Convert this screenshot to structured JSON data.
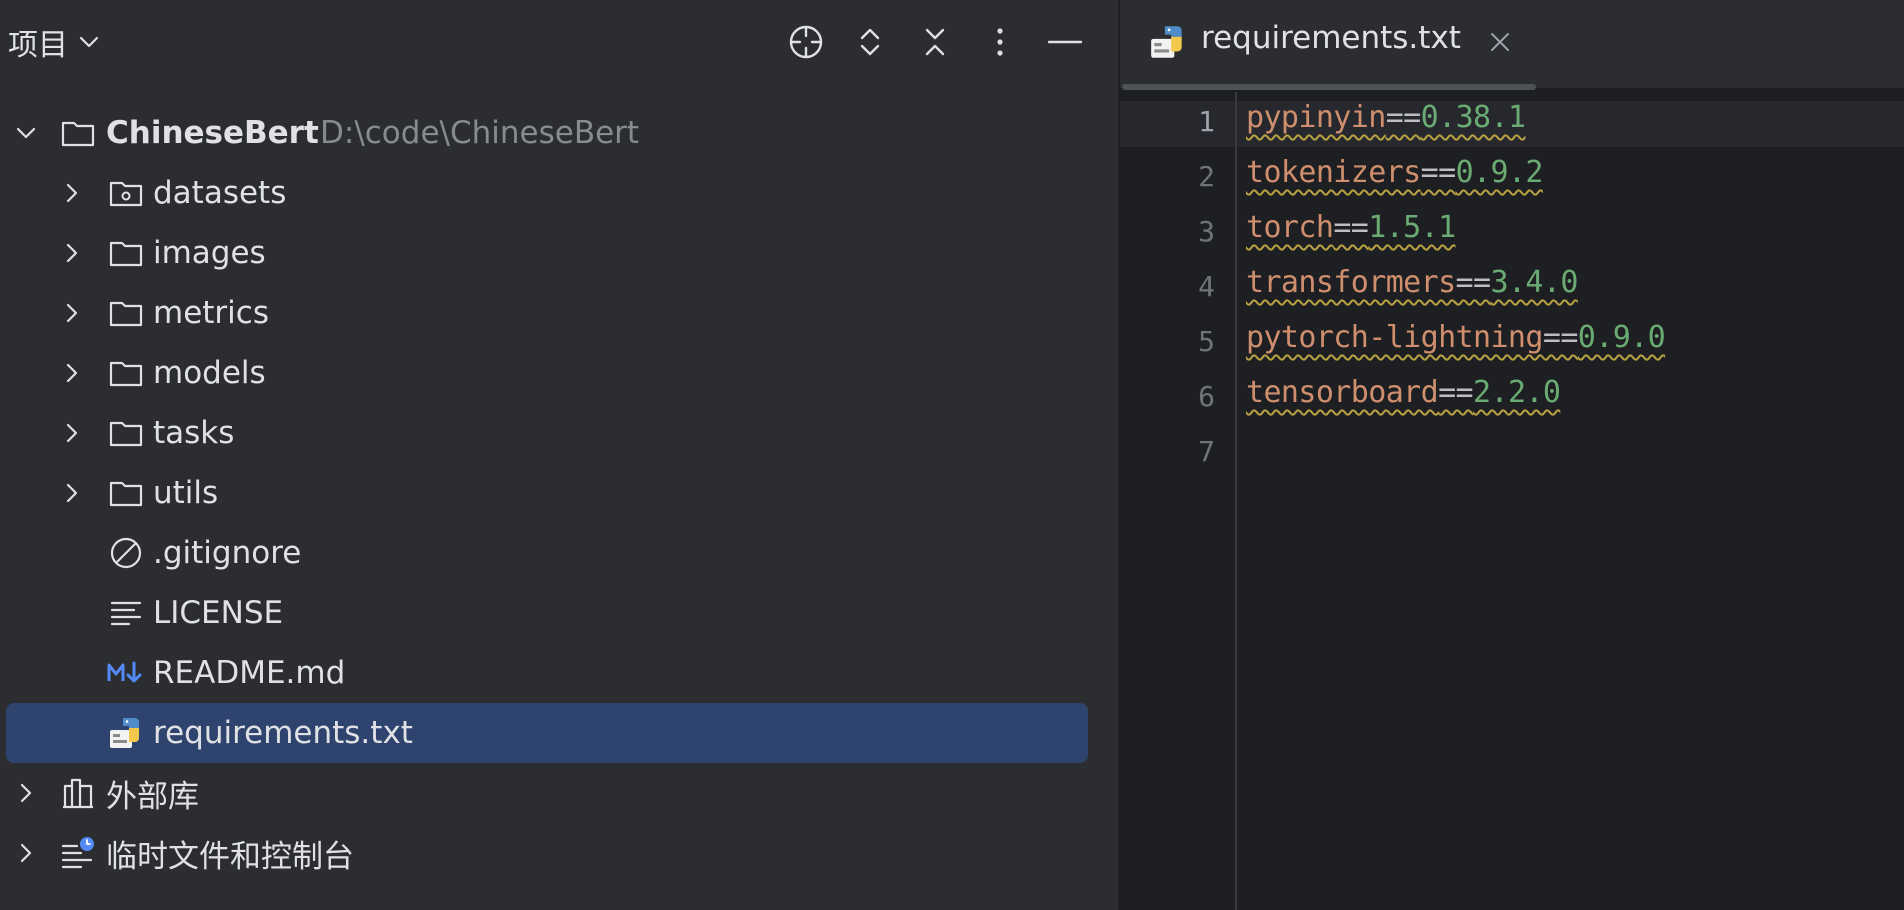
{
  "panel": {
    "title": "项目",
    "header_icons": [
      "crosshair-icon",
      "expand-collapse-icon",
      "collapse-all-icon",
      "more-vertical-icon",
      "minimize-icon"
    ]
  },
  "tree": {
    "root": {
      "name": "ChineseBert",
      "path": "D:\\code\\ChineseBert"
    },
    "items": [
      {
        "label": "datasets",
        "icon": "folder-resources-icon",
        "expandable": true
      },
      {
        "label": "images",
        "icon": "folder-icon",
        "expandable": true
      },
      {
        "label": "metrics",
        "icon": "folder-icon",
        "expandable": true
      },
      {
        "label": "models",
        "icon": "folder-icon",
        "expandable": true
      },
      {
        "label": "tasks",
        "icon": "folder-icon",
        "expandable": true
      },
      {
        "label": "utils",
        "icon": "folder-icon",
        "expandable": true
      },
      {
        "label": ".gitignore",
        "icon": "ignore-file-icon",
        "expandable": false
      },
      {
        "label": "LICENSE",
        "icon": "text-file-icon",
        "expandable": false
      },
      {
        "label": "README.md",
        "icon": "markdown-icon",
        "expandable": false
      },
      {
        "label": "requirements.txt",
        "icon": "python-requirements-icon",
        "expandable": false,
        "selected": true
      }
    ],
    "external_libraries": "外部库",
    "scratches": "临时文件和控制台"
  },
  "editor": {
    "tab": {
      "label": "requirements.txt",
      "icon": "python-requirements-icon"
    },
    "active_line": 1,
    "line_numbers": [
      "1",
      "2",
      "3",
      "4",
      "5",
      "6",
      "7"
    ],
    "lines": [
      {
        "pkg": "pypinyin",
        "op": "==",
        "ver": "0.38.1"
      },
      {
        "pkg": "tokenizers",
        "op": "==",
        "ver": "0.9.2"
      },
      {
        "pkg": "torch",
        "op": "==",
        "ver": "1.5.1"
      },
      {
        "pkg": "transformers",
        "op": "==",
        "ver": "3.4.0"
      },
      {
        "pkg": "pytorch-lightning",
        "op": "==",
        "ver": "0.9.0"
      },
      {
        "pkg": "tensorboard",
        "op": "==",
        "ver": "2.2.0"
      }
    ]
  },
  "colors": {
    "panel_bg": "#2b2d30",
    "editor_bg": "#1e1f22",
    "selection": "#2e436e",
    "keyword": "#cf8e6d",
    "number": "#6aab73",
    "warning_underline": "#b8a243",
    "markdown_blue": "#548af7"
  }
}
